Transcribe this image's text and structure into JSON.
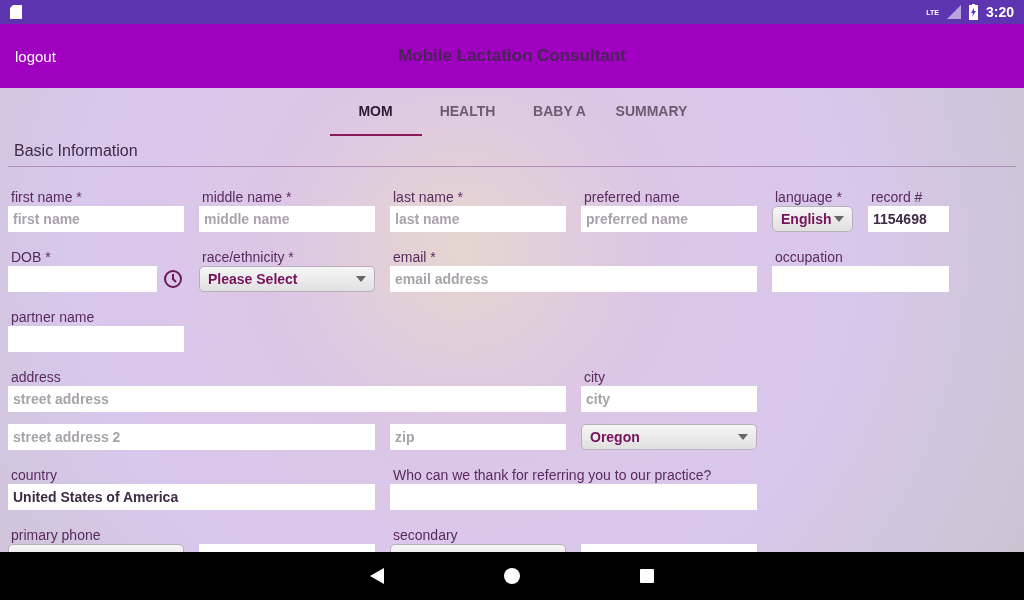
{
  "status_bar": {
    "network": "LTE",
    "time": "3:20"
  },
  "app_bar": {
    "logout": "logout",
    "title": "Mobile Lactation Consultant"
  },
  "tabs": [
    {
      "label": "MOM",
      "selected": true
    },
    {
      "label": "HEALTH",
      "selected": false
    },
    {
      "label": "BABY A",
      "selected": false
    },
    {
      "label": "SUMMARY",
      "selected": false
    }
  ],
  "section_title": "Basic Information",
  "rows": [
    [
      {
        "kind": "text",
        "label": "first name *",
        "placeholder": "first name"
      },
      {
        "kind": "text",
        "label": "middle name *",
        "placeholder": "middle name"
      },
      {
        "kind": "text",
        "label": "last name *",
        "placeholder": "last name"
      },
      {
        "kind": "text",
        "label": "preferred name",
        "placeholder": "preferred name"
      },
      {
        "kind": "select",
        "label": "language *",
        "value": "English"
      },
      {
        "kind": "text",
        "label": "record #",
        "value": "1154698"
      }
    ],
    [
      {
        "kind": "date",
        "label": "DOB *"
      },
      {
        "kind": "select",
        "label": "race/ethnicity *",
        "value": "Please Select"
      },
      {
        "kind": "text",
        "label": "email *",
        "placeholder": "email address"
      },
      {
        "kind": "text",
        "label": "occupation"
      }
    ],
    [
      {
        "kind": "text",
        "label": "partner name"
      }
    ],
    [
      {
        "kind": "text",
        "label": "address",
        "placeholder": "street address"
      },
      {
        "kind": "text",
        "label": "city",
        "placeholder": "city"
      }
    ],
    [
      {
        "kind": "text",
        "placeholder": "street address 2"
      },
      {
        "kind": "text",
        "placeholder": "zip"
      },
      {
        "kind": "select",
        "value": "Oregon"
      }
    ],
    [
      {
        "kind": "text",
        "label": "country",
        "value": "United States of America"
      },
      {
        "kind": "text",
        "label": "Who can we thank for referring you to our practice?"
      }
    ],
    [
      {
        "kind": "select",
        "label": "primary phone"
      },
      {
        "kind": "text"
      },
      {
        "kind": "select",
        "label": "secondary"
      },
      {
        "kind": "text"
      }
    ]
  ]
}
